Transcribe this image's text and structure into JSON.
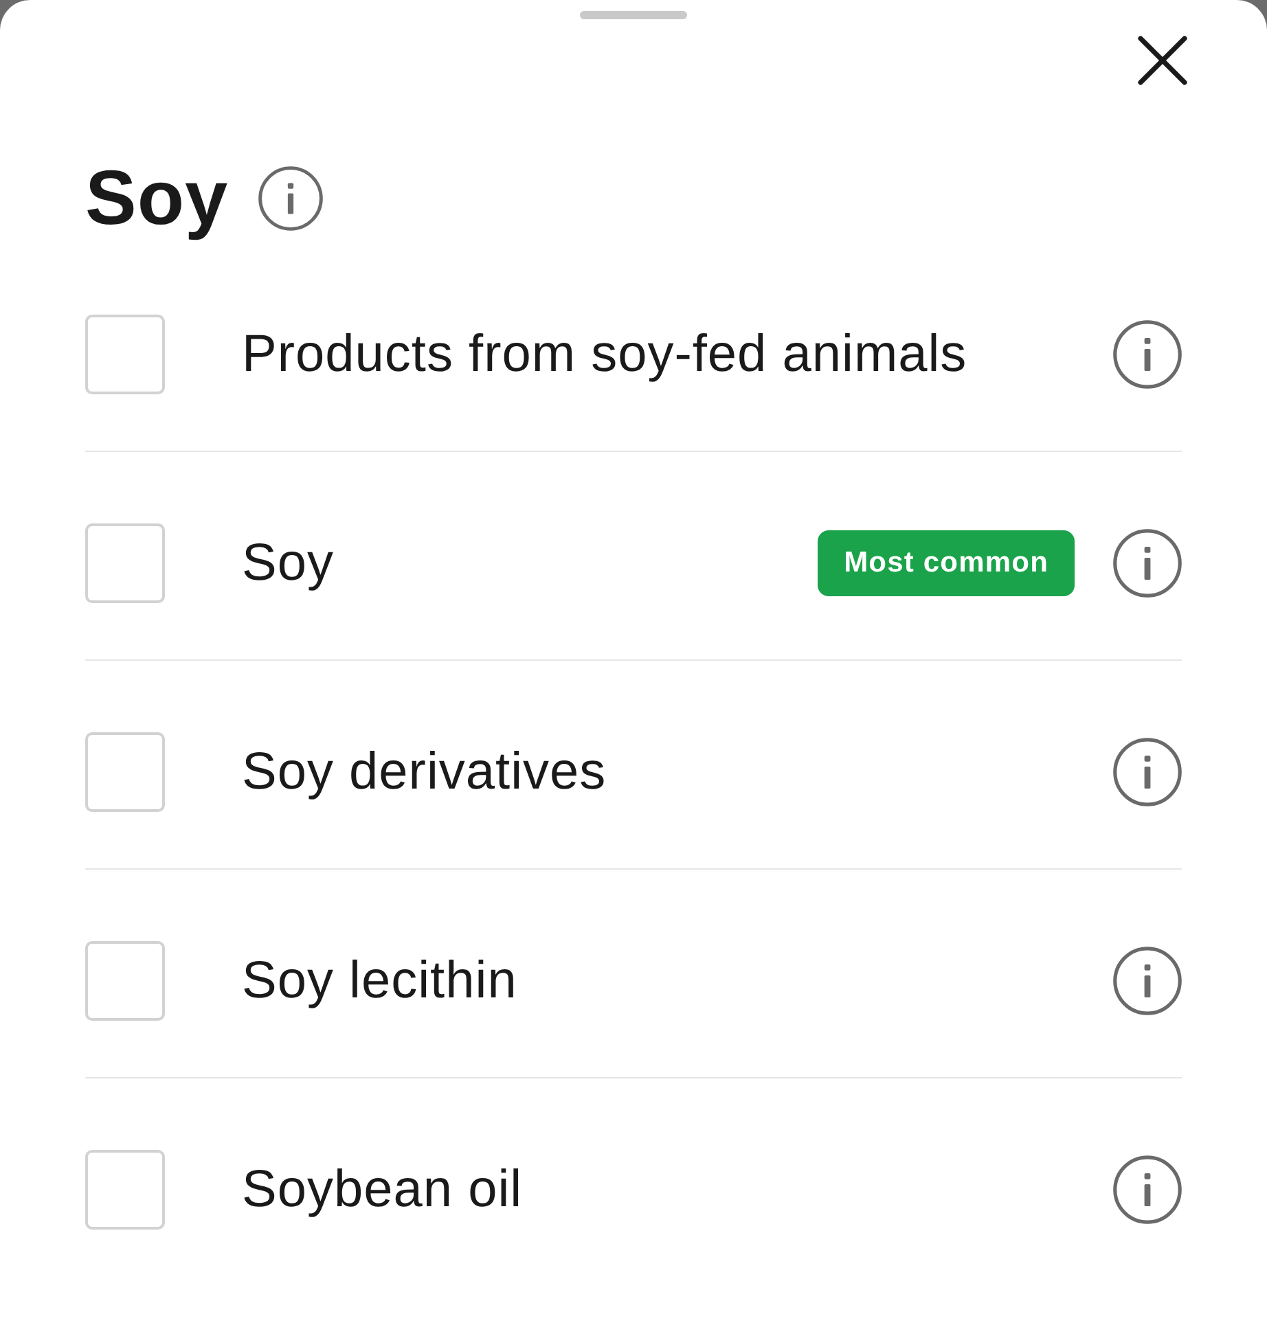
{
  "sheet": {
    "title": "Soy",
    "items": [
      {
        "label": "Products from soy-fed animals",
        "checked": false
      },
      {
        "label": "Soy",
        "checked": false,
        "badge": "Most common"
      },
      {
        "label": "Soy derivatives",
        "checked": false
      },
      {
        "label": "Soy lecithin",
        "checked": false
      },
      {
        "label": "Soybean oil",
        "checked": false
      }
    ]
  }
}
